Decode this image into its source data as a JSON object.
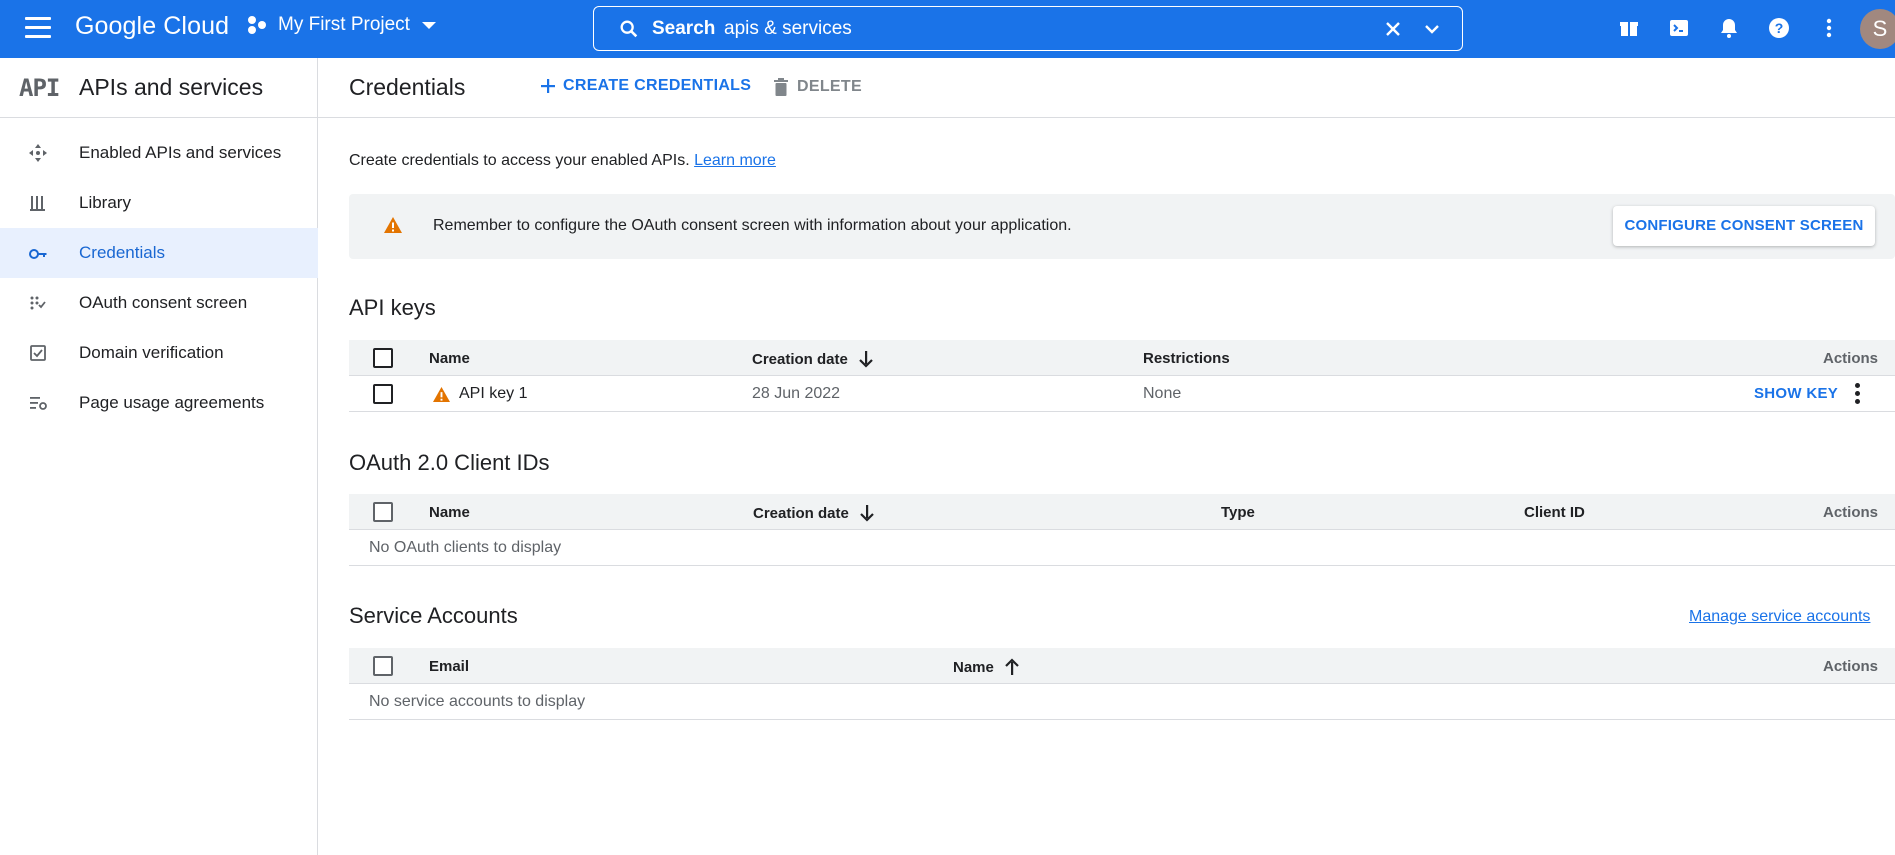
{
  "topbar": {
    "brand": "Google Cloud",
    "project": "My First Project",
    "search": {
      "label": "Search",
      "value": "apis & services"
    },
    "avatar_initial": "S",
    "icons": [
      "gift-icon",
      "cloud-shell-icon",
      "notifications-icon",
      "help-icon",
      "more-vert-icon"
    ]
  },
  "sidebar": {
    "logo": "API",
    "title": "APIs and services",
    "items": [
      {
        "label": "Enabled APIs and services",
        "icon": "enabled-apis-icon"
      },
      {
        "label": "Library",
        "icon": "library-icon"
      },
      {
        "label": "Credentials",
        "icon": "key-icon",
        "active": true
      },
      {
        "label": "OAuth consent screen",
        "icon": "oauth-icon"
      },
      {
        "label": "Domain verification",
        "icon": "domain-check-icon"
      },
      {
        "label": "Page usage agreements",
        "icon": "settings-list-icon"
      }
    ]
  },
  "main": {
    "title": "Credentials",
    "create_label": "CREATE CREDENTIALS",
    "delete_label": "DELETE",
    "intro_text": "Create credentials to access your enabled APIs.",
    "learn_more": "Learn more",
    "banner": {
      "text": "Remember to configure the OAuth consent screen with information about your application.",
      "button": "CONFIGURE CONSENT SCREEN"
    },
    "api_keys": {
      "title": "API keys",
      "columns": [
        "Name",
        "Creation date",
        "Restrictions",
        "Actions"
      ],
      "rows": [
        {
          "name": "API key 1",
          "created": "28 Jun 2022",
          "restrictions": "None",
          "action": "SHOW KEY"
        }
      ]
    },
    "oauth": {
      "title": "OAuth 2.0 Client IDs",
      "columns": [
        "Name",
        "Creation date",
        "Type",
        "Client ID",
        "Actions"
      ],
      "empty": "No OAuth clients to display"
    },
    "service_accounts": {
      "title": "Service Accounts",
      "manage_link": "Manage service accounts",
      "columns": [
        "Email",
        "Name",
        "Actions"
      ],
      "empty": "No service accounts to display"
    }
  },
  "colors": {
    "topbar": "#1a73e8",
    "accent": "#1a73e8",
    "active_bg": "#e8f0fe",
    "warning": "#e37400",
    "table_header": "#f1f3f4"
  }
}
